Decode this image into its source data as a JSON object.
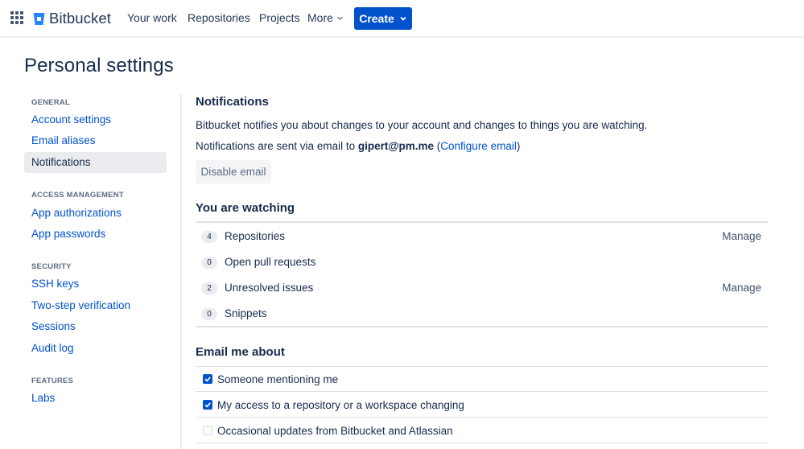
{
  "nav": {
    "brand": "Bitbucket",
    "items": [
      "Your work",
      "Repositories",
      "Projects"
    ],
    "more_label": "More",
    "create_label": "Create"
  },
  "page": {
    "title": "Personal settings"
  },
  "sidebar": {
    "groups": [
      {
        "heading": "GENERAL",
        "items": [
          "Account settings",
          "Email aliases",
          "Notifications"
        ]
      },
      {
        "heading": "ACCESS MANAGEMENT",
        "items": [
          "App authorizations",
          "App passwords"
        ]
      },
      {
        "heading": "SECURITY",
        "items": [
          "SSH keys",
          "Two-step verification",
          "Sessions",
          "Audit log"
        ]
      },
      {
        "heading": "FEATURES",
        "items": [
          "Labs"
        ]
      }
    ],
    "active": "Notifications"
  },
  "notifications": {
    "heading": "Notifications",
    "description": "Bitbucket notifies you about changes to your account and changes to things you are watching.",
    "sent_prefix": "Notifications are sent via email to ",
    "email": "gipert@pm.me",
    "paren_open": " (",
    "configure_link": "Configure email",
    "paren_close": ")",
    "disable_button": "Disable email"
  },
  "watching": {
    "heading": "You are watching",
    "manage_label": "Manage",
    "rows": [
      {
        "count": "4",
        "label": "Repositories",
        "manage": true
      },
      {
        "count": "0",
        "label": "Open pull requests",
        "manage": false
      },
      {
        "count": "2",
        "label": "Unresolved issues",
        "manage": true
      },
      {
        "count": "0",
        "label": "Snippets",
        "manage": false
      }
    ]
  },
  "email_me": {
    "heading": "Email me about",
    "options": [
      {
        "label": "Someone mentioning me",
        "checked": true
      },
      {
        "label": "My access to a repository or a workspace changing",
        "checked": true
      },
      {
        "label": "Occasional updates from Bitbucket and Atlassian",
        "checked": false
      }
    ]
  },
  "colors": {
    "brand": "#0052cc",
    "text": "#172b4d",
    "muted": "#5e6c84"
  }
}
